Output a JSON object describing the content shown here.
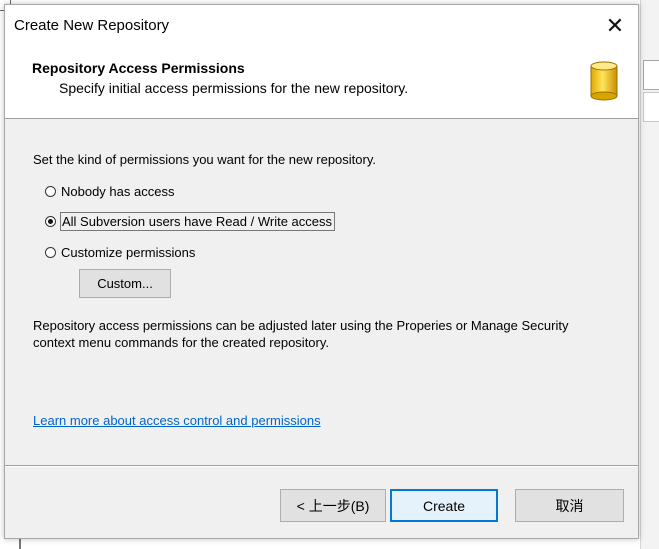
{
  "window": {
    "title": "Create New Repository",
    "close_glyph": "✕"
  },
  "header": {
    "title": "Repository Access Permissions",
    "subtitle": "Specify initial access permissions for the new repository.",
    "icon": "database-icon",
    "icon_color": "#f2c400"
  },
  "body": {
    "instructions": "Set the kind of permissions you want for the new repository.",
    "options": [
      {
        "label": "Nobody has access",
        "checked": false
      },
      {
        "label": "All Subversion users have Read / Write access",
        "checked": true
      },
      {
        "label": "Customize permissions",
        "checked": false
      }
    ],
    "custom_button": "Custom...",
    "note": "Repository access permissions can be adjusted later using the Properies or Manage Security context menu commands for the created repository.",
    "learn_more_link": "Learn more about access control and permissions"
  },
  "footer": {
    "back_button": "< 上一步(B)",
    "create_button": "Create",
    "cancel_button": "取消",
    "focus_color": "#0078d7"
  }
}
